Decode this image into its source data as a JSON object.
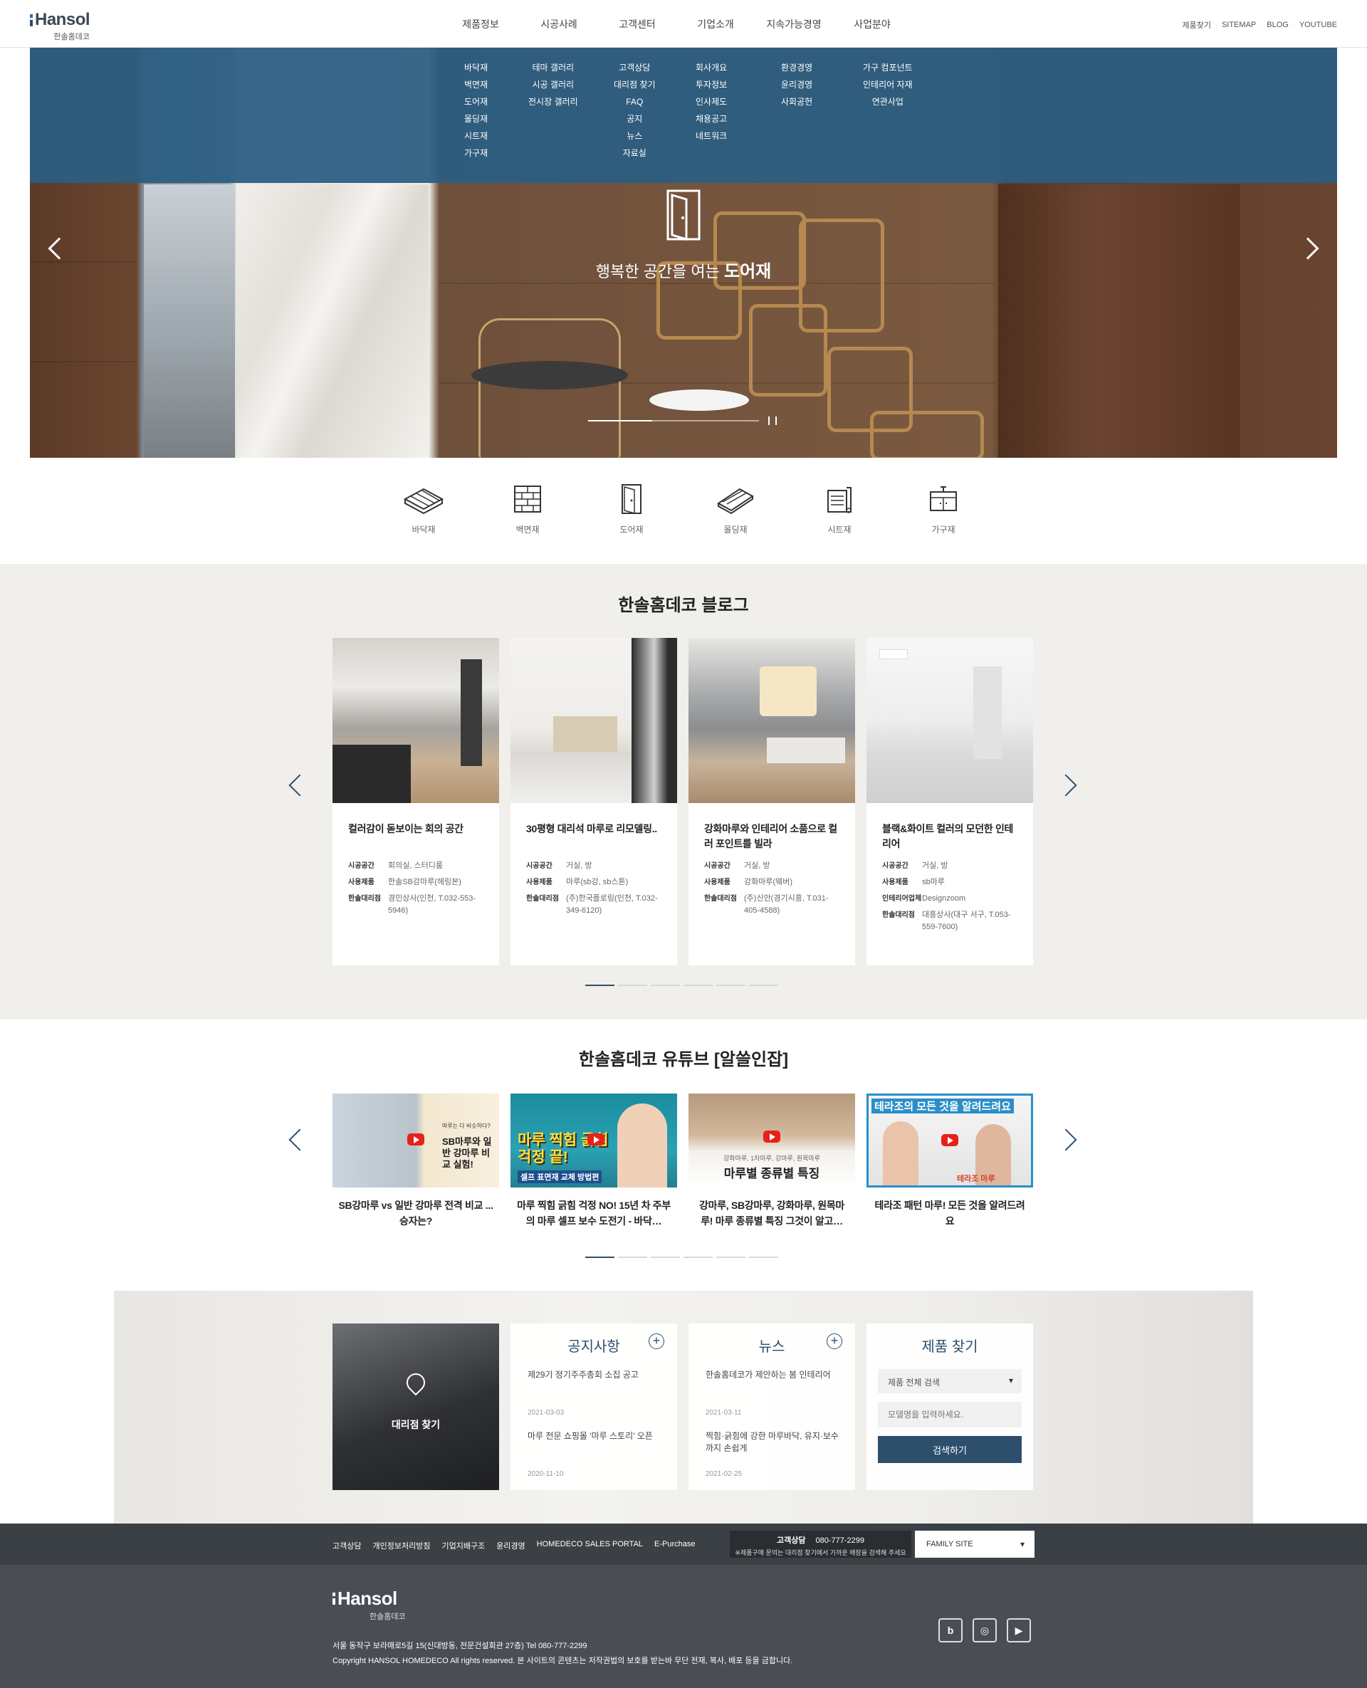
{
  "header": {
    "logo_text": "Hansol",
    "logo_sub": "한솔홈데코",
    "gnb": [
      "제품정보",
      "시공사례",
      "고객센터",
      "기업소개",
      "지속가능경영",
      "사업분야"
    ],
    "util": [
      "제품찾기",
      "SITEMAP",
      "BLOG",
      "YOUTUBE"
    ]
  },
  "submenu": [
    [
      "바닥재",
      "벽면재",
      "도어재",
      "몰딩재",
      "시트재",
      "가구재"
    ],
    [
      "테마 갤러리",
      "시공 갤러리",
      "전시장 갤러리"
    ],
    [
      "고객상담",
      "대리점 찾기",
      "FAQ",
      "공지",
      "뉴스",
      "자료실"
    ],
    [
      "회사개요",
      "투자정보",
      "인사제도",
      "채용공고",
      "네트워크"
    ],
    [
      "환경경영",
      "윤리경영",
      "사회공헌"
    ],
    [
      "가구 컴포넌트",
      "인테리어 자재",
      "연관사업"
    ]
  ],
  "hero": {
    "caption_prefix": "행복한 공간을 여는",
    "caption_bold": "도어재",
    "pause_label": "❙❙",
    "progress": 0.375
  },
  "categories": [
    {
      "label": "바닥재",
      "icon": "floor-icon"
    },
    {
      "label": "벽면재",
      "icon": "wall-icon"
    },
    {
      "label": "도어재",
      "icon": "door-icon"
    },
    {
      "label": "몰딩재",
      "icon": "molding-icon"
    },
    {
      "label": "시트재",
      "icon": "sheet-icon"
    },
    {
      "label": "가구재",
      "icon": "furniture-icon"
    }
  ],
  "blog": {
    "title": "한솔홈데코 블로그",
    "cards": [
      {
        "title": "컬러감이 돋보이는 회의 공간",
        "meta": [
          [
            "시공공간",
            "회의실, 스터디룸"
          ],
          [
            "사용제품",
            "한솔SB강마루(헤링본)"
          ],
          [
            "한솔대리점",
            "경민상사(인천, T.032-553-5946)"
          ]
        ]
      },
      {
        "title": "30평형 대리석 마루로 리모델링..",
        "meta": [
          [
            "시공공간",
            "거실, 방"
          ],
          [
            "사용제품",
            "마루(sb강, sb스톤)"
          ],
          [
            "한솔대리점",
            "(주)한국플로링(인천, T.032-349-6120)"
          ]
        ]
      },
      {
        "title": "강화마루와 인테리어 소품으로 컬러 포인트를 빌라",
        "meta": [
          [
            "시공공간",
            "거실, 방"
          ],
          [
            "사용제품",
            "강화마루(웨버)"
          ],
          [
            "한솔대리점",
            "(주)신안(경기시흥, T.031-405-4588)"
          ]
        ]
      },
      {
        "title": "블랙&화이트 컬러의 모던한 인테리어",
        "meta": [
          [
            "시공공간",
            "거실, 방"
          ],
          [
            "사용제품",
            "sb마루"
          ],
          [
            "인테리어업체",
            "Designzoom"
          ],
          [
            "한솔대리점",
            "대흥상사(대구 서구, T.053-559-7600)"
          ]
        ]
      }
    ],
    "dots": 6,
    "active_dot": 0
  },
  "youtube": {
    "title": "한솔홈데코 유튜브 [알쓸인잡]",
    "cards": [
      {
        "title": "SB강마루 vs 일반 강마루 전격 비교 ...승자는?",
        "thumb_text": "SB마루와 일반 강마루 비교 실험!",
        "thumb_small": "마루는 다 비슷하다?"
      },
      {
        "title": "마루 찍힘 긁힘 걱정 NO! 15년 차 주부의 마루 셀프 보수 도전기 - 바닥…",
        "thumb_text": "마루 찍힘 긁힘 걱정 끝!",
        "thumb_small": "셀프 표면재 교체 방법편"
      },
      {
        "title": "강마루, SB강마루, 강화마루, 원목마루! 마루 종류별 특징 그것이 알고…",
        "thumb_text": "마루별 종류별 특징",
        "thumb_small": "강화마루, 1차마루, 강마루, 원목마루"
      },
      {
        "title": "테라조 패턴 마루! 모든 것을 알려드려요",
        "thumb_text": "테라조의 모든 것을 알려드려요",
        "thumb_small": "테라조 마루"
      }
    ],
    "dots": 6,
    "active_dot": 0
  },
  "info": {
    "dealer_label": "대리점 찾기",
    "notice": {
      "title": "공지사항",
      "items": [
        {
          "text": "제29기 정기주주총회 소집 공고",
          "date": "2021-03-03"
        },
        {
          "text": "마루 전문 쇼핑몰 '마루 스토리' 오픈",
          "date": "2020-11-10"
        }
      ]
    },
    "news": {
      "title": "뉴스",
      "items": [
        {
          "text": "한솔홈데코가 제안하는 봄 인테리어",
          "date": "2021-03-11"
        },
        {
          "text": "찍힘·긁힘에 강한 마루바닥, 유지·보수까지 손쉽게",
          "date": "2021-02-25"
        }
      ]
    },
    "search": {
      "title": "제품 찾기",
      "select_value": "제품 전체 검색",
      "input_placeholder": "모델명을 입력하세요.",
      "button_label": "검색하기"
    }
  },
  "footer": {
    "links": [
      "고객상담",
      "개인정보처리방침",
      "기업지배구조",
      "윤리경영",
      "HOMEDECO SALES PORTAL",
      "E-Purchase"
    ],
    "cs_label": "고객상담",
    "cs_phone": "080-777-2299",
    "cs_note": "※제품구매 문의는 대리점 찾기에서 가까운 매장을 검색해 주세요",
    "family_site": "FAMILY SITE",
    "logo_text": "Hansol",
    "logo_sub": "한솔홈데코",
    "address": "서울 동작구 보라매로5길 15(신대방동, 전문건설회관 27층)     Tel 080-777-2299",
    "copyright": "Copyright HANSOL HOMEDECO All rights reserved. 본 사이트의 콘텐츠는 저작권법의 보호를 받는바 무단 전재, 복사, 배포 등을 금합니다.",
    "sns": [
      {
        "icon": "blog-icon",
        "glyph": "b"
      },
      {
        "icon": "instagram-icon",
        "glyph": "◎"
      },
      {
        "icon": "youtube-icon",
        "glyph": "▶"
      }
    ]
  },
  "colors": {
    "primary": "#2d4f6c",
    "dropdown": "#2c5e82",
    "footer_dark": "#3b4045",
    "footer": "#4a4e54",
    "blog_bg": "#f0efeb"
  }
}
